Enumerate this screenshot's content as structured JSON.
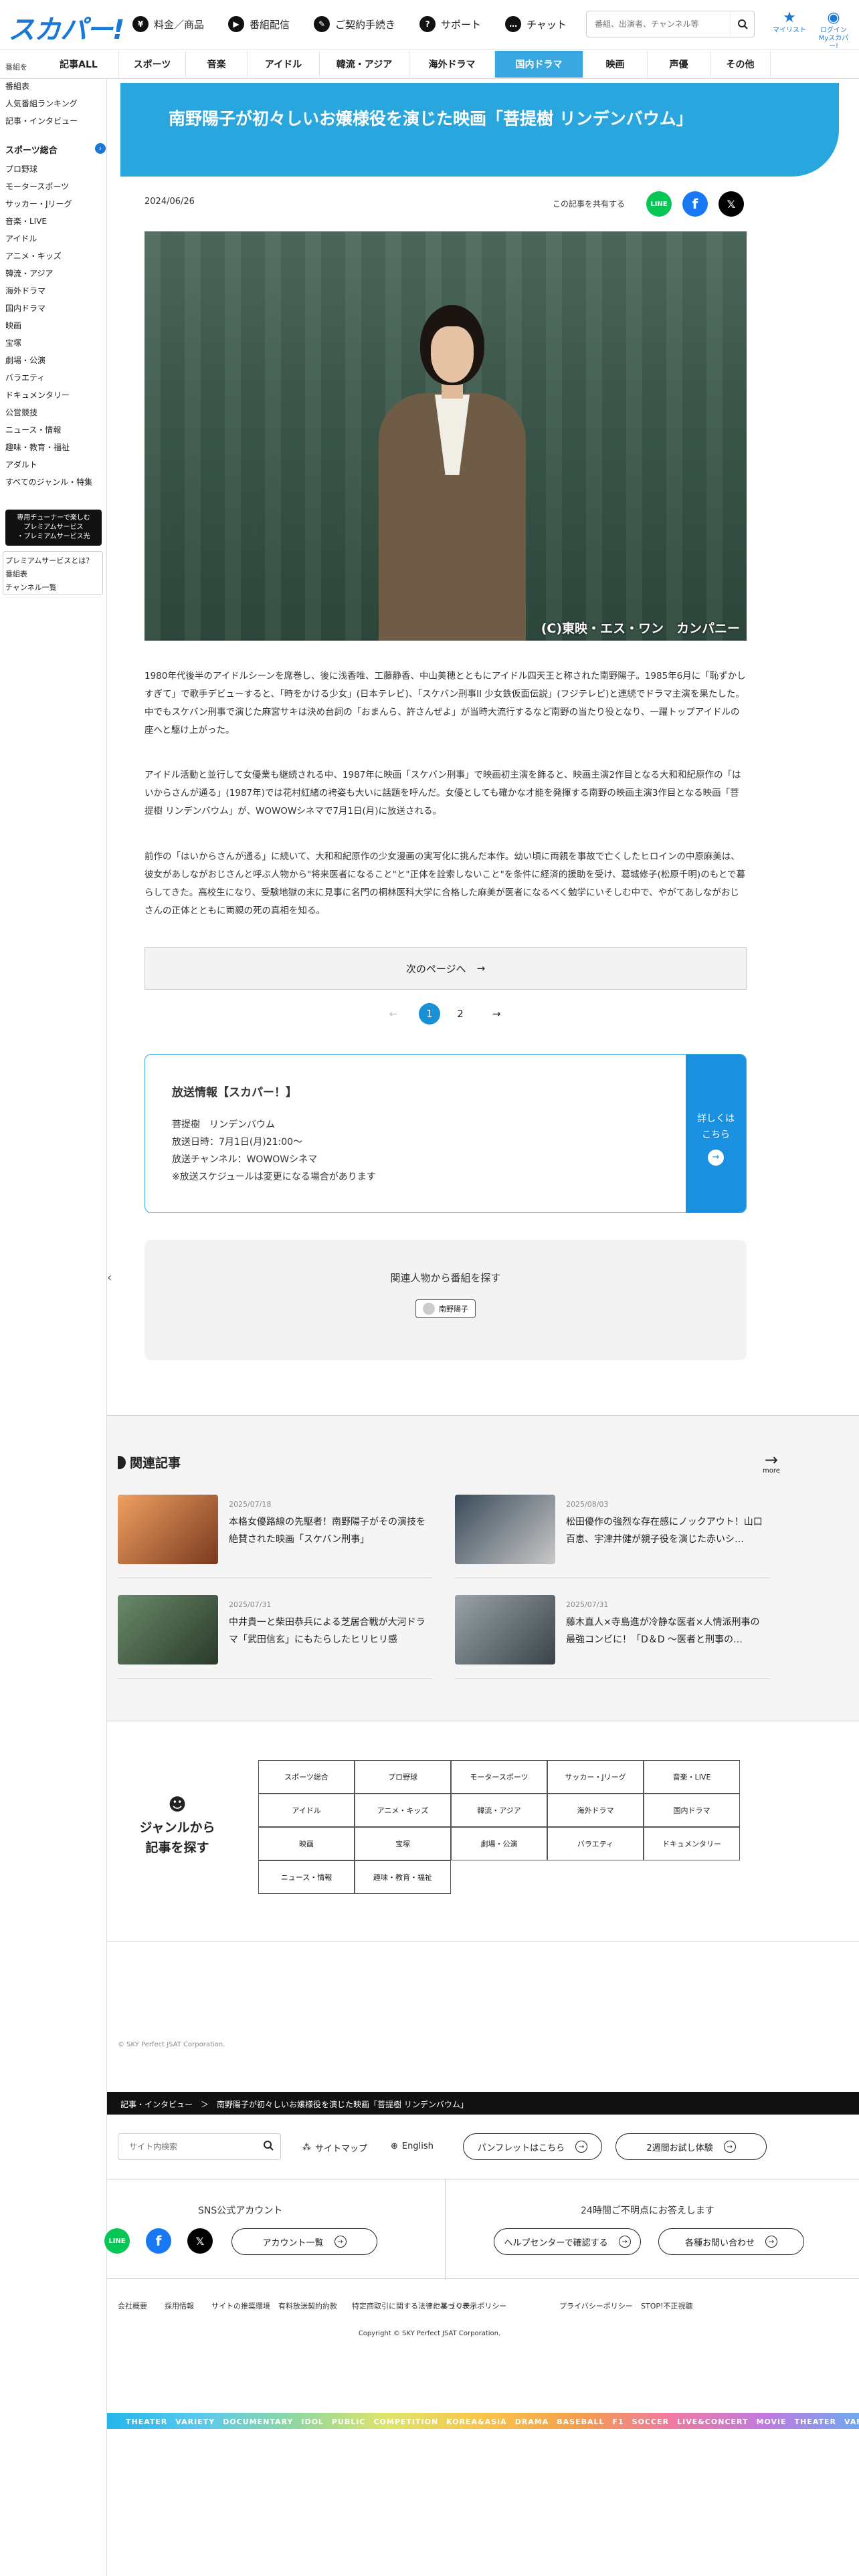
{
  "header": {
    "logo": "スカパー!",
    "nav": [
      {
        "label": "料金／商品",
        "icon": "yen-icon",
        "glyph": "¥"
      },
      {
        "label": "番組配信",
        "icon": "play-icon",
        "glyph": "▶"
      },
      {
        "label": "ご契約手続き",
        "icon": "pen-icon",
        "glyph": "✎"
      },
      {
        "label": "サポート",
        "icon": "question-icon",
        "glyph": "?"
      },
      {
        "label": "チャット",
        "icon": "chat-icon",
        "glyph": "…"
      }
    ],
    "search_placeholder": "番組、出演者、チャンネル等",
    "mylist": "マイリスト",
    "login": "ログイン\nMyスカパー!"
  },
  "genre_tabs": {
    "label": "番組を",
    "items": [
      "記事ALL",
      "スポーツ",
      "音楽",
      "アイドル",
      "韓流・アジア",
      "海外ドラマ",
      "国内ドラマ",
      "映画",
      "声優",
      "その他"
    ],
    "active": "国内ドラマ"
  },
  "sidebar": {
    "top_items": [
      "番組表",
      "人気番組ランキング",
      "記事・インタビュー"
    ],
    "section": "スポーツ総合",
    "items": [
      "プロ野球",
      "モータースポーツ",
      "サッカー・Jリーグ",
      "音楽・LIVE",
      "アイドル",
      "アニメ・キッズ",
      "韓流・アジア",
      "海外ドラマ",
      "国内ドラマ",
      "映画",
      "宝塚",
      "劇場・公演",
      "バラエティ",
      "ドキュメンタリー",
      "公営競技",
      "ニュース・情報",
      "趣味・教育・福祉",
      "アダルト",
      "すべてのジャンル・特集"
    ],
    "banner": "専用チューナーで楽しむ\nプレミアムサービス\n・プレミアムサービス光",
    "bottom_items": [
      "プレミアムサービスとは？",
      "番組表",
      "チャンネル一覧"
    ]
  },
  "article": {
    "title": "南野陽子が初々しいお嬢様役を演じた映画「菩提樹 リンデンバウム」",
    "date": "2024/06/26",
    "share_label": "この記事を共有する",
    "photo_credit": "(C)東映・エス・ワン　カンパニー",
    "paragraphs": [
      "1980年代後半のアイドルシーンを席巻し、後に浅香唯、工藤静香、中山美穂とともにアイドル四天王と称された南野陽子。1985年6月に「恥ずかしすぎて」で歌手デビューすると、「時をかける少女」(日本テレビ)、「スケバン刑事II 少女鉄仮面伝説」(フジテレビ)と連続でドラマ主演を果たした。中でもスケバン刑事で演じた麻宮サキは決め台詞の「おまんら、許さんぜよ」が当時大流行するなど南野の当たり役となり、一躍トップアイドルの座へと駆け上がった。",
      "アイドル活動と並行して女優業も継続される中、1987年に映画「スケバン刑事」で映画初主演を飾ると、映画主演2作目となる大和和紀原作の「はいからさんが通る」(1987年)では花村紅緒の袴姿も大いに話題を呼んだ。女優としても確かな才能を発揮する南野の映画主演3作目となる映画「菩提樹 リンデンバウム」が、WOWOWシネマで7月1日(月)に放送される。",
      "前作の「はいからさんが通る」に続いて、大和和紀原作の少女漫画の実写化に挑んだ本作。幼い頃に両親を事故で亡くしたヒロインの中原麻美は、彼女があしながおじさんと呼ぶ人物から\"将来医者になること\"と\"正体を詮索しないこと\"を条件に経済的援助を受け、葛城修子(松原千明)のもとで暮らしてきた。高校生になり、受験地獄の末に見事に名門の桐林医科大学に合格した麻美が医者になるべく勉学にいそしむ中で、やがてあしながおじさんの正体とともに両親の死の真相を知る。"
    ],
    "next_page": "次のページへ",
    "pages": [
      "1",
      "2"
    ],
    "current_page": "1"
  },
  "broadcast": {
    "title": "放送情報【スカパー！】",
    "lines": [
      "菩提樹　リンデンバウム",
      "放送日時：7月1日(月)21:00～",
      "放送チャンネル：WOWOWシネマ",
      "※放送スケジュールは変更になる場合があります"
    ],
    "more": "詳しくは\nこちら"
  },
  "related_people": {
    "title": "関連人物から番組を探す",
    "chip": "南野陽子"
  },
  "related_articles": {
    "title": "関連記事",
    "more": "more",
    "items": [
      {
        "date": "2025/07/18",
        "title": "本格女優路線の先駆者！南野陽子がその演技を絶賛された映画「スケバン刑事」"
      },
      {
        "date": "2025/08/03",
        "title": "松田優作の強烈な存在感にノックアウト！山口百恵、宇津井健が親子役を演じた赤いシ…"
      },
      {
        "date": "2025/07/31",
        "title": "中井貴一と柴田恭兵による芝居合戦が大河ドラマ「武田信玄」にもたらしたヒリヒリ感"
      },
      {
        "date": "2025/07/31",
        "title": "藤木直人×寺島進が冷静な医者×人情派刑事の最強コンビに！「D＆D ～医者と刑事の…"
      }
    ]
  },
  "genre_search": {
    "label": "ジャンルから\n記事を探す",
    "items": [
      "スポーツ総合",
      "プロ野球",
      "モータースポーツ",
      "サッカー・Jリーグ",
      "音楽・LIVE",
      "アイドル",
      "アニメ・キッズ",
      "韓流・アジア",
      "海外ドラマ",
      "国内ドラマ",
      "映画",
      "宝塚",
      "劇場・公演",
      "バラエティ",
      "ドキュメンタリー",
      "ニュース・情報",
      "趣味・教育・福祉"
    ]
  },
  "footer": {
    "copyright_small": "© SKY Perfect JSAT Corporation.",
    "breadcrumb": "記事・インタビュー　＞　南野陽子が初々しいお嬢様役を演じた映画「菩提樹 リンデンバウム」",
    "search_placeholder": "サイト内検索",
    "sitemap": "サイトマップ",
    "english": "English",
    "pamphlet": "パンフレットはこちら",
    "trial": "2週間お試し体験",
    "sns_title": "SNS公式アカウント",
    "accounts": "アカウント一覧",
    "support_title": "24時間ご不明点にお答えします",
    "helpcenter": "ヘルプセンターで確認する",
    "contact": "各種お問い合わせ",
    "links": [
      "会社概要",
      "採用情報",
      "サイトの推奨環境",
      "有料放送契約約款",
      "特定商取引に関する法律に基づく表示",
      "セキュリティポリシー",
      "プライバシーポリシー",
      "STOP!不正視聴"
    ],
    "copyright": "Copyright © SKY Perfect JSAT Corporation.",
    "ticker": "THEATER　VARIETY　DOCUMENTARY　IDOL　PUBLIC　COMPETITION　KOREA&ASIA　DRAMA　BASEBALL　F1　SOCCER　LIVE&CONCERT　MOVIE　THEATER　VARIETY"
  },
  "colors": {
    "brand": "#1a78d6",
    "accent": "#2aa6df",
    "line": "#06c755",
    "facebook": "#1877f2",
    "x": "#000000"
  }
}
